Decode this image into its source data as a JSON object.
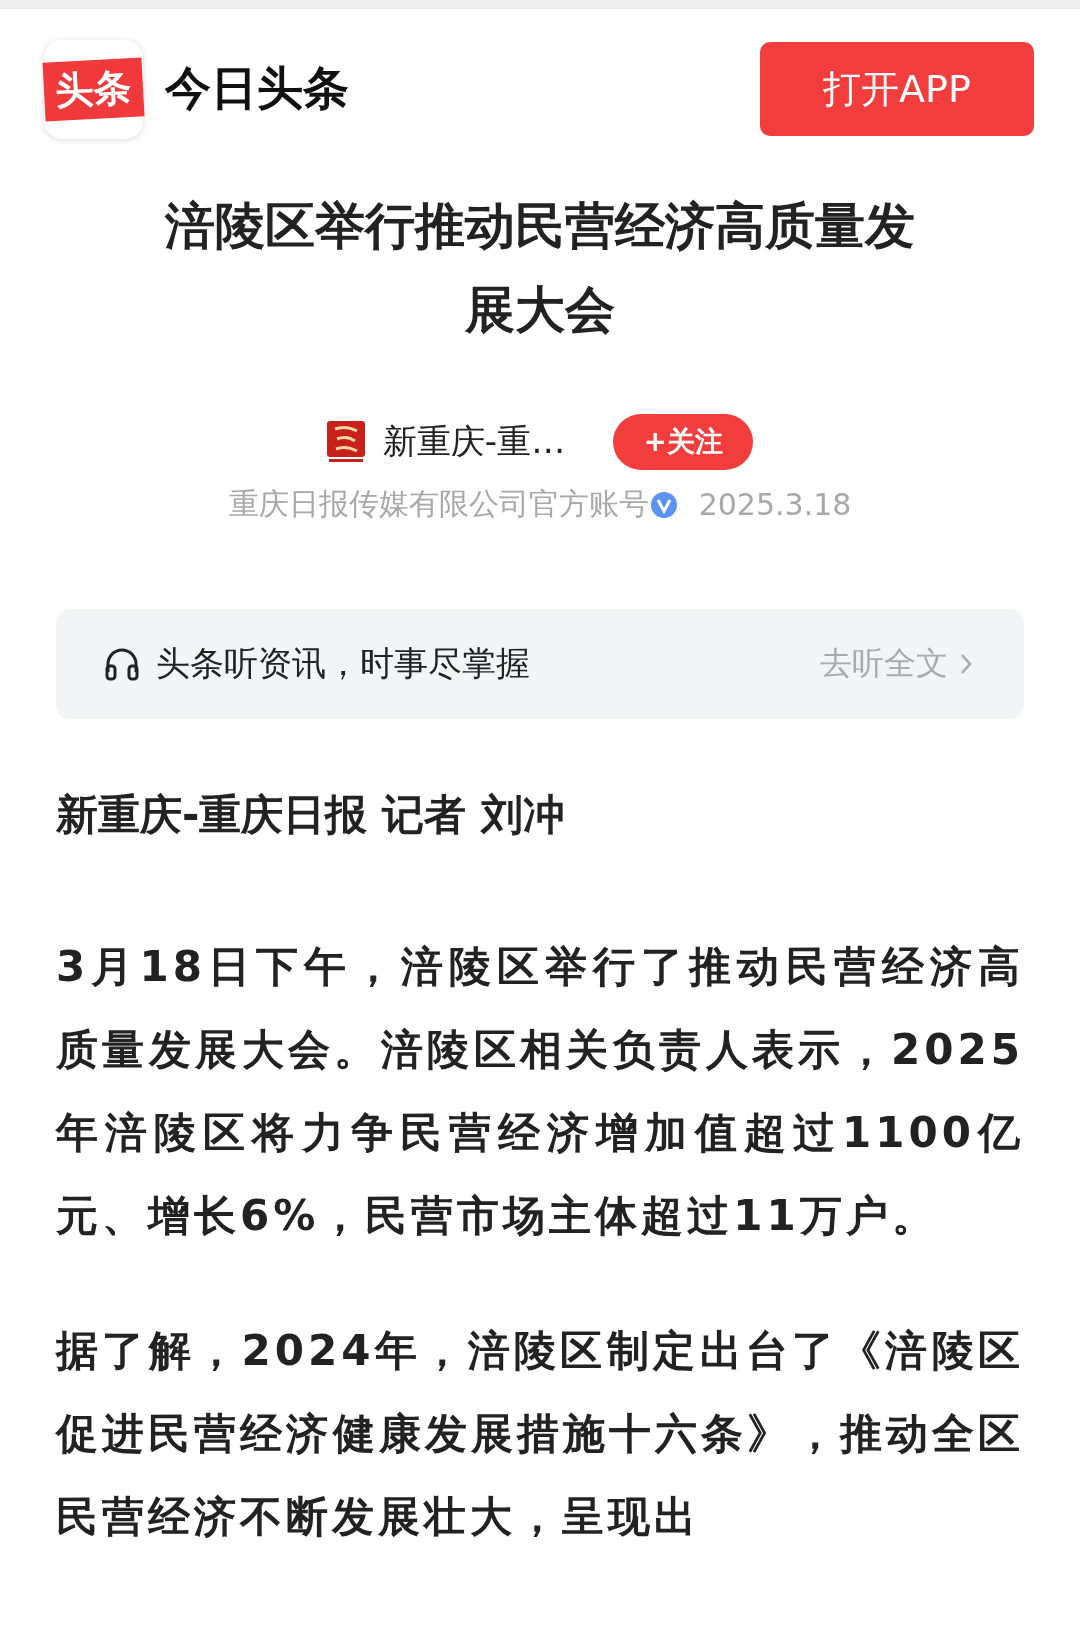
{
  "header": {
    "logo_text": "头条",
    "app_name": "今日头条",
    "open_button": "打开APP"
  },
  "article": {
    "title": "涪陵区举行推动民营经济高质量发展大会",
    "author": {
      "name": "新重庆-重…",
      "follow_button": "+关注",
      "description": "重庆日报传媒有限公司官方账号",
      "verified": true,
      "date": "2025.3.18"
    },
    "listen_bar": {
      "text": "头条听资讯，时事尽掌握",
      "action": "去听全文"
    },
    "byline": "新重庆-重庆日报 记者 刘冲",
    "paragraphs": [
      "3月18日下午，涪陵区举行了推动民营经济高质量发展大会。涪陵区相关负责人表示，2025年涪陵区将力争民营经济增加值超过1100亿元、增长6%，民营市场主体超过11万户。",
      "据了解，2024年，涪陵区制定出台了《涪陵区促进民营经济健康发展措施十六条》，推动全区民营经济不断发展壮大，呈现出"
    ]
  }
}
